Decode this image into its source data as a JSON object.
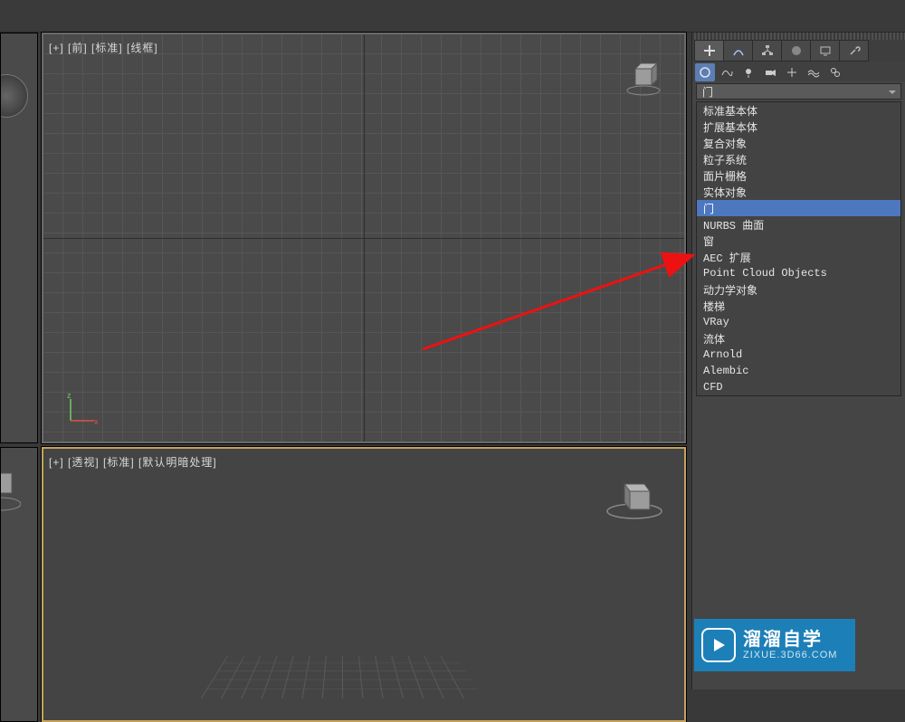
{
  "viewports": {
    "front_label": "[+] [前] [标准] [线框]",
    "persp_label": "[+] [透视] [标准] [默认明暗处理]"
  },
  "panel": {
    "dropdown_selected": "门",
    "items": [
      {
        "label": "标准基本体",
        "selected": false
      },
      {
        "label": "扩展基本体",
        "selected": false
      },
      {
        "label": "复合对象",
        "selected": false
      },
      {
        "label": "粒子系统",
        "selected": false
      },
      {
        "label": "面片栅格",
        "selected": false
      },
      {
        "label": "实体对象",
        "selected": false
      },
      {
        "label": "门",
        "selected": true
      },
      {
        "label": "NURBS 曲面",
        "selected": false
      },
      {
        "label": "窗",
        "selected": false
      },
      {
        "label": "AEC 扩展",
        "selected": false
      },
      {
        "label": "Point Cloud Objects",
        "selected": false
      },
      {
        "label": "动力学对象",
        "selected": false
      },
      {
        "label": "楼梯",
        "selected": false
      },
      {
        "label": "VRay",
        "selected": false
      },
      {
        "label": "流体",
        "selected": false
      },
      {
        "label": "Arnold",
        "selected": false
      },
      {
        "label": "Alembic",
        "selected": false
      },
      {
        "label": "CFD",
        "selected": false
      }
    ]
  },
  "watermark": {
    "cn": "溜溜自学",
    "en": "ZIXUE.3D66.COM"
  }
}
